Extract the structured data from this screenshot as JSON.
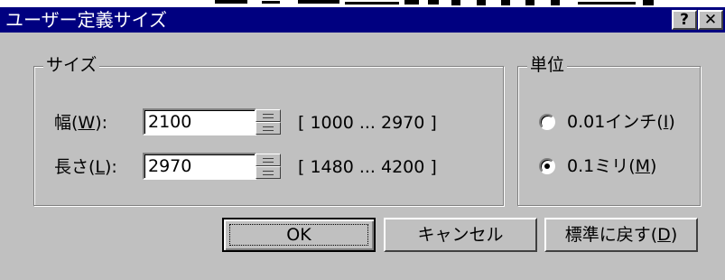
{
  "window": {
    "title": "ユーザー定義サイズ",
    "help_glyph": "?",
    "close_glyph": "✕"
  },
  "size_group": {
    "label": "サイズ",
    "width": {
      "label": "幅(",
      "accel": "W",
      "label_end": "):",
      "value": "2100",
      "range": "[ 1000 ... 2970 ]"
    },
    "length": {
      "label": "長さ(",
      "accel": "L",
      "label_end": "):",
      "value": "2970",
      "range": "[ 1480 ... 4200 ]"
    }
  },
  "unit_group": {
    "label": "単位",
    "options": [
      {
        "label": "0.01インチ(",
        "accel": "I",
        "label_end": ")",
        "selected": false
      },
      {
        "label": "0.1ミリ(",
        "accel": "M",
        "label_end": ")",
        "selected": true
      }
    ]
  },
  "buttons": {
    "ok": "OK",
    "cancel": "キャンセル",
    "reset_label": "標準に戻す(",
    "reset_accel": "D",
    "reset_end": ")"
  },
  "colors": {
    "titlebar": "#000080",
    "face": "#c0c0c0"
  }
}
